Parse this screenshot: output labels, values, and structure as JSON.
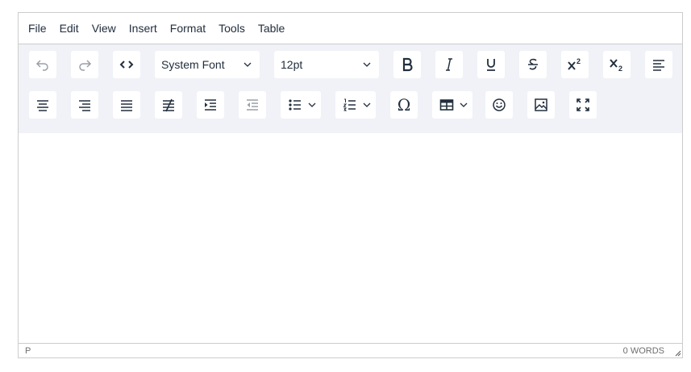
{
  "menubar": {
    "items": [
      {
        "label": "File"
      },
      {
        "label": "Edit"
      },
      {
        "label": "View"
      },
      {
        "label": "Insert"
      },
      {
        "label": "Format"
      },
      {
        "label": "Tools"
      },
      {
        "label": "Table"
      }
    ]
  },
  "toolbar": {
    "font_family": "System Font",
    "font_size": "12pt",
    "omega_glyph": "Ω",
    "icons": [
      "undo-icon",
      "redo-icon",
      "source-code-icon",
      "bold-icon",
      "italic-icon",
      "underline-icon",
      "strikethrough-icon",
      "superscript-icon",
      "subscript-icon",
      "align-left-icon",
      "align-center-icon",
      "align-right-icon",
      "align-justify-icon",
      "clear-formatting-icon",
      "indent-icon",
      "outdent-icon",
      "bullet-list-icon",
      "numbered-list-icon",
      "special-character-icon",
      "table-icon",
      "emoticons-icon",
      "image-icon",
      "fullscreen-icon"
    ]
  },
  "statusbar": {
    "path": "P",
    "word_count": "0 WORDS"
  },
  "colors": {
    "toolbar_bg": "#f0f2f7",
    "text": "#222f3e",
    "border": "#cccccc"
  }
}
